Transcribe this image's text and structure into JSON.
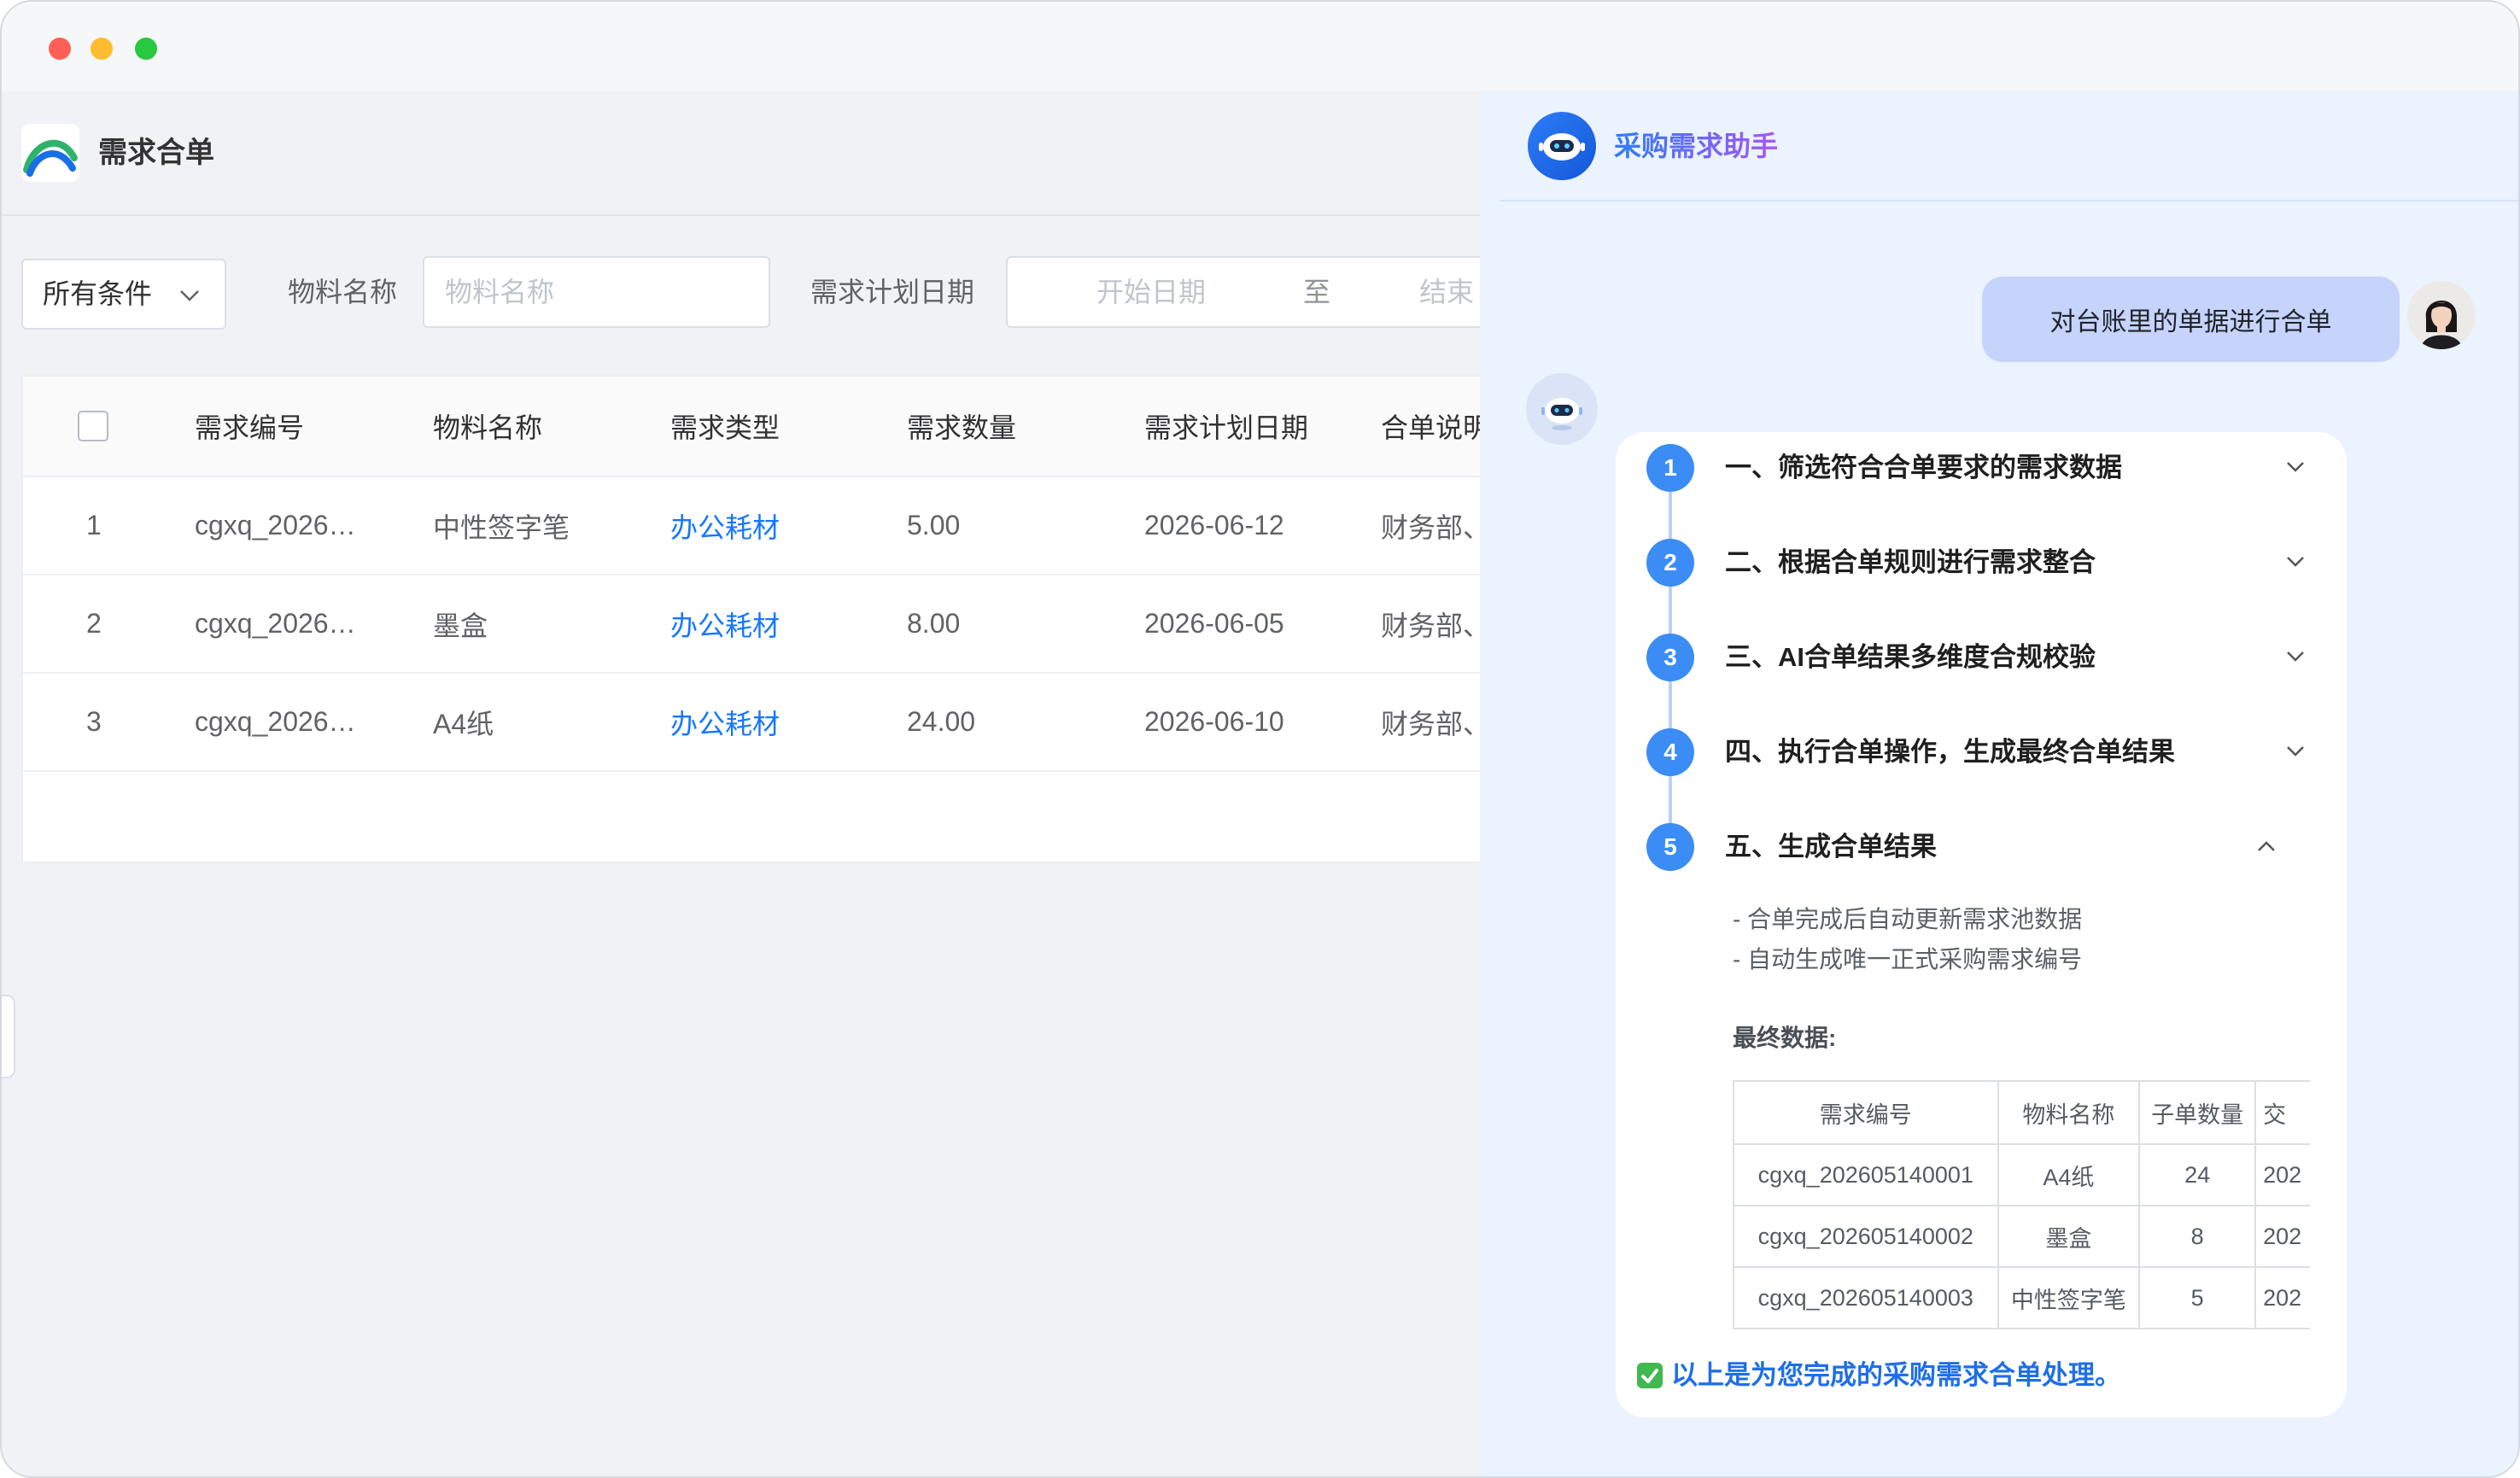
{
  "app": {
    "title": "需求合单"
  },
  "filters": {
    "condition_select": "所有条件",
    "material_label": "物料名称",
    "material_placeholder": "物料名称",
    "date_label": "需求计划日期",
    "date_start_placeholder": "开始日期",
    "date_separator": "至",
    "date_end_placeholder": "结束"
  },
  "table": {
    "columns": [
      "需求编号",
      "物料名称",
      "需求类型",
      "需求数量",
      "需求计划日期",
      "合单说明"
    ],
    "rows": [
      {
        "index": "1",
        "id": "cgxq_2026…",
        "material": "中性签字笔",
        "type": "办公耗材",
        "qty": "5.00",
        "date": "2026-06-12",
        "note": "财务部、"
      },
      {
        "index": "2",
        "id": "cgxq_2026…",
        "material": "墨盒",
        "type": "办公耗材",
        "qty": "8.00",
        "date": "2026-06-05",
        "note": "财务部、"
      },
      {
        "index": "3",
        "id": "cgxq_2026…",
        "material": "A4纸",
        "type": "办公耗材",
        "qty": "24.00",
        "date": "2026-06-10",
        "note": "财务部、"
      }
    ]
  },
  "assistant": {
    "title": "采购需求助手",
    "user_message": "对台账里的单据进行合单",
    "steps": [
      {
        "number": "1",
        "label": "一、筛选符合合单要求的需求数据",
        "expanded": false
      },
      {
        "number": "2",
        "label": "二、根据合单规则进行需求整合",
        "expanded": false
      },
      {
        "number": "3",
        "label": "三、AI合单结果多维度合规校验",
        "expanded": false
      },
      {
        "number": "4",
        "label": "四、执行合单操作，生成最终合单结果",
        "expanded": false
      },
      {
        "number": "5",
        "label": "五、生成合单结果",
        "expanded": true
      }
    ],
    "step5_details": [
      "- 合单完成后自动更新需求池数据",
      "- 自动生成唯一正式采购需求编号"
    ],
    "final_data_label": "最终数据:",
    "result_table": {
      "columns": [
        "需求编号",
        "物料名称",
        "子单数量",
        "交"
      ],
      "rows": [
        [
          "cgxq_202605140001",
          "A4纸",
          "24",
          "202"
        ],
        [
          "cgxq_202605140002",
          "墨盒",
          "8",
          "202"
        ],
        [
          "cgxq_202605140003",
          "中性签字笔",
          "5",
          "202"
        ]
      ]
    },
    "completion_message": "以上是为您完成的采购需求合单处理。"
  },
  "icons": {
    "logo": "app-logo-icon",
    "assistant": "robot-icon",
    "check": "check-mark-icon"
  },
  "colors": {
    "accent": "#1677ff",
    "step": "#3b8cf5",
    "assistant_panel": "#ebf3fe",
    "user_bubble": "#c6d3fb",
    "completion_text": "#1e6fe8"
  }
}
